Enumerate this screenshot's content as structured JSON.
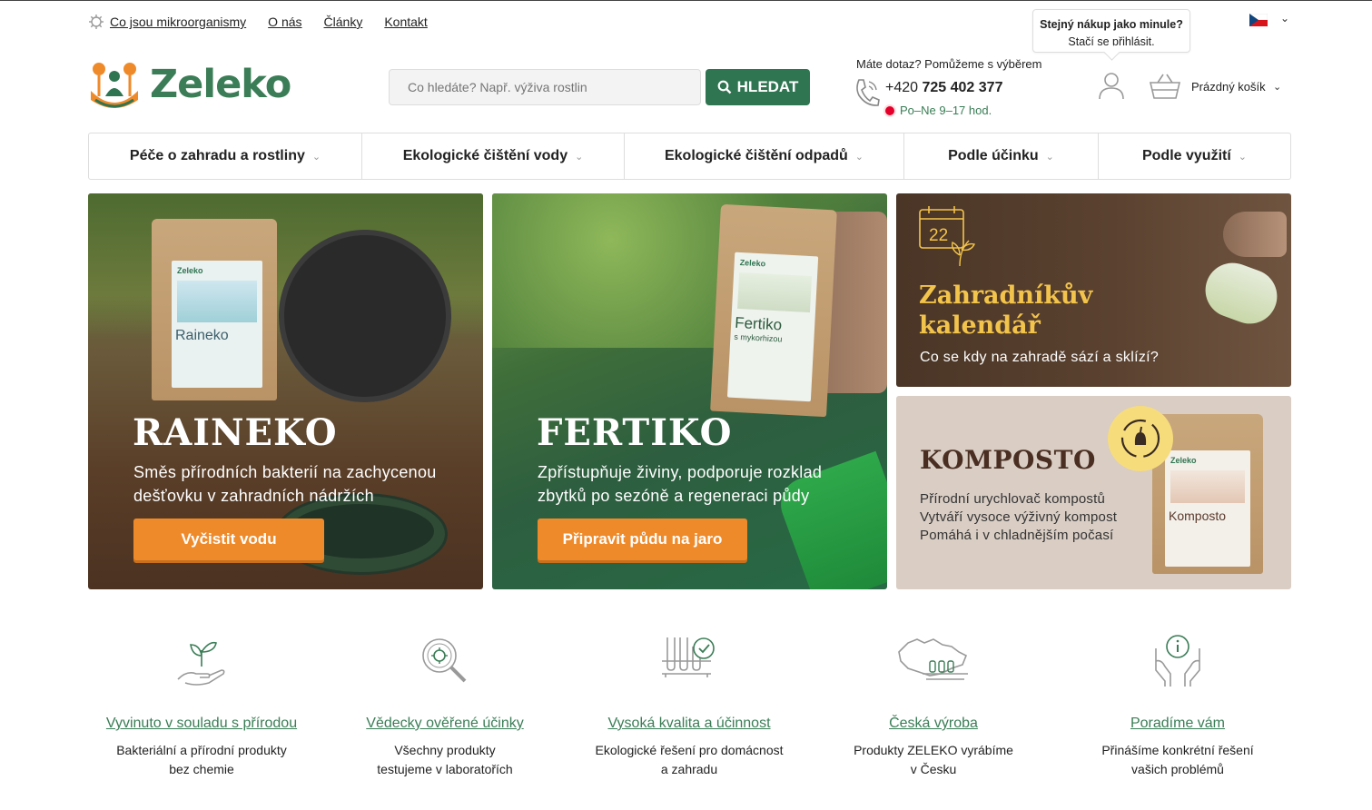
{
  "top_links": [
    "Co jsou mikroorganismy",
    "O nás",
    "Články",
    "Kontakt"
  ],
  "tooltip": {
    "title": "Stejný nákup jako minule?",
    "text": "Stačí se přihlásit."
  },
  "logo": {
    "text": "Zeleko"
  },
  "search": {
    "placeholder": "Co hledáte? Např. výživa rostlin",
    "button": "HLEDAT"
  },
  "contact": {
    "question": "Máte dotaz? Pomůžeme s výběrem",
    "phone_prefix": "+420 ",
    "phone_number": "725 402 377",
    "hours": "Po–Ne 9–17 hod."
  },
  "cart": {
    "label": "Prázdný košík"
  },
  "nav": [
    "Péče o zahradu a rostliny",
    "Ekologické čištění vody",
    "Ekologické čištění odpadů",
    "Podle účinku",
    "Podle využití"
  ],
  "banners": {
    "raineko": {
      "title": "RAINEKO",
      "subtitle_line1": "Směs přírodních bakterií na zachycenou",
      "subtitle_line2": "dešťovku v zahradních nádržích",
      "button": "Vyčistit vodu",
      "pouch_brand": "Zeleko",
      "pouch_name": "Raineko"
    },
    "fertiko": {
      "title": "FERTIKO",
      "subtitle_line1": "Zpřístupňuje živiny, podporuje rozklad",
      "subtitle_line2": "zbytků po sezóně a regeneraci půdy",
      "button": "Připravit půdu na jaro",
      "pouch_brand": "Zeleko",
      "pouch_name": "Fertiko",
      "pouch_sub": "s mykorhizou"
    },
    "calendar": {
      "day": "22",
      "title_line1": "Zahradníkův",
      "title_line2": "kalendář",
      "subtitle": "Co se kdy na zahradě sází a sklízí?"
    },
    "komposto": {
      "title": "KOMPOSTO",
      "line1": "Přírodní urychlovač kompostů",
      "line2": "Vytváří vysoce výživný kompost",
      "line3": "Pomáhá i v chladnějším počasí",
      "pouch_brand": "Zeleko",
      "pouch_name": "Komposto"
    }
  },
  "features": [
    {
      "icon": "plant-hand-icon",
      "title": "Vyvinuto v souladu s přírodou",
      "desc_line1": "Bakteriální a přírodní produkty",
      "desc_line2": "bez chemie"
    },
    {
      "icon": "magnifier-bacteria-icon",
      "title": "Vědecky ověřené účinky",
      "desc_line1": "Všechny produkty",
      "desc_line2": "testujeme v laboratořích"
    },
    {
      "icon": "test-tubes-check-icon",
      "title": "Vysoká kvalita a účinnost",
      "desc_line1": "Ekologické řešení pro domácnost",
      "desc_line2": "a zahradu"
    },
    {
      "icon": "czech-map-icon",
      "title": "Česká výroba",
      "desc_line1": "Produkty ZELEKO vyrábíme",
      "desc_line2": "v Česku"
    },
    {
      "icon": "hands-info-icon",
      "title": "Poradíme vám",
      "desc_line1": "Přinášíme konkrétní řešení",
      "desc_line2": "vašich problémů"
    }
  ],
  "colors": {
    "brand_green": "#3a7d56",
    "button_green": "#2f7551",
    "orange": "#ef8a2a",
    "calendar_gold": "#f3c44b"
  }
}
